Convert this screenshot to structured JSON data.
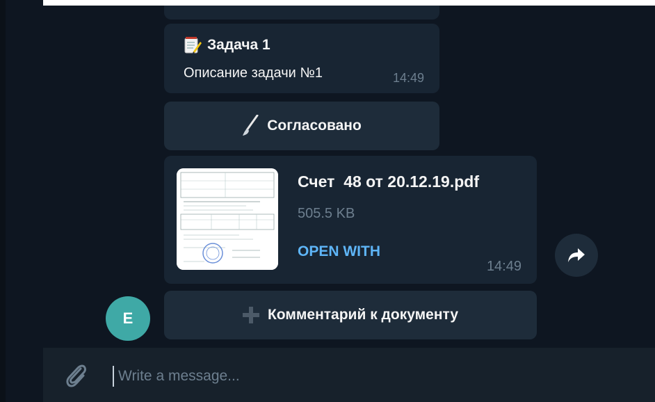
{
  "messages": {
    "task": {
      "icon": "memo-icon",
      "title": "Задача 1",
      "description": "Описание задачи №1",
      "time": "14:49"
    },
    "approve_button": {
      "icon": "paintbrush-icon",
      "label": "Согласовано"
    },
    "file": {
      "name": "Счет  48 от 20.12.19.pdf",
      "size": "505.5 KB",
      "action": "OPEN WITH",
      "time": "14:49"
    },
    "comment_button": {
      "icon": "plus-icon",
      "label": "Комментарий к документу"
    }
  },
  "sender": {
    "avatar_letter": "E"
  },
  "share": {
    "icon": "forward-arrow-icon"
  },
  "composer": {
    "attach_icon": "paperclip-icon",
    "placeholder": "Write a message..."
  },
  "colors": {
    "background": "#0e1621",
    "bubble": "#182533",
    "accent_link": "#5eb5f7",
    "avatar": "#3fa9a6",
    "muted_text": "#6d7f8f"
  }
}
